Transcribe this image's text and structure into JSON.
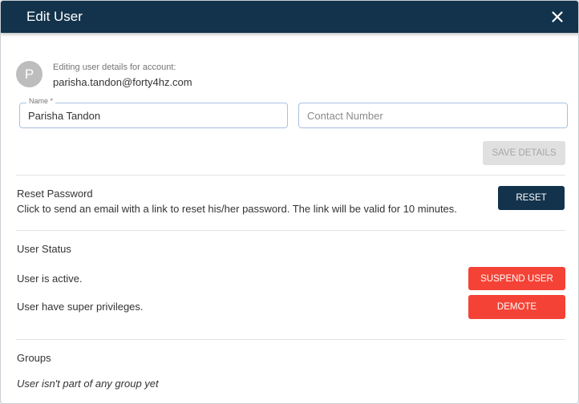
{
  "dialog": {
    "title": "Edit User",
    "close_icon": "close-icon"
  },
  "account": {
    "avatar_initial": "P",
    "caption": "Editing user details for account:",
    "email": "parisha.tandon@forty4hz.com"
  },
  "form": {
    "name_label": "Name *",
    "name_value": "Parisha Tandon",
    "contact_placeholder": "Contact Number",
    "save_label": "SAVE DETAILS",
    "save_disabled": true
  },
  "reset_password": {
    "title": "Reset Password",
    "description": "Click to send an email with a link to reset his/her password. The link will be valid for 10 minutes.",
    "button_label": "RESET"
  },
  "user_status": {
    "title": "User Status",
    "active_text": "User is active.",
    "suspend_label": "SUSPEND USER",
    "privileges_text": "User have super privileges.",
    "demote_label": "DEMOTE"
  },
  "groups": {
    "title": "Groups",
    "empty_text": "User isn't part of any group yet"
  },
  "colors": {
    "header_bg": "#13334c",
    "danger": "#f44336",
    "field_border": "#a9bfe0"
  }
}
